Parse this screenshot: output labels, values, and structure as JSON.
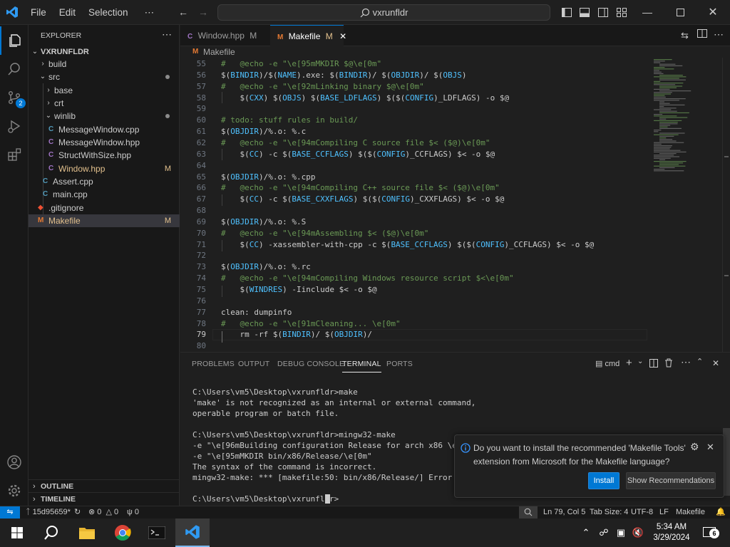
{
  "titlebar": {
    "menus": [
      "File",
      "Edit",
      "Selection",
      "⋯"
    ],
    "search": "vxrunfldr"
  },
  "sidebar": {
    "header": "EXPLORER",
    "more": "⋯",
    "root": "VXRUNFLDR",
    "items": [
      {
        "label": "build",
        "badge": ""
      },
      {
        "label": "src",
        "badge": "dot"
      },
      {
        "label": "base",
        "badge": ""
      },
      {
        "label": "crt",
        "badge": ""
      },
      {
        "label": "winlib",
        "badge": "dot"
      },
      {
        "label": "MessageWindow.cpp",
        "badge": ""
      },
      {
        "label": "MessageWindow.hpp",
        "badge": ""
      },
      {
        "label": "StructWithSize.hpp",
        "badge": ""
      },
      {
        "label": "Window.hpp",
        "badge": "M"
      },
      {
        "label": "Assert.cpp",
        "badge": ""
      },
      {
        "label": "main.cpp",
        "badge": ""
      },
      {
        "label": ".gitignore",
        "badge": ""
      },
      {
        "label": "Makefile",
        "badge": "M"
      }
    ],
    "outline": "OUTLINE",
    "timeline": "TIMELINE"
  },
  "activity": {
    "scm_badge": "2"
  },
  "tabs": [
    {
      "label": "Window.hpp",
      "suffix": "M"
    },
    {
      "label": "Makefile",
      "suffix": "M"
    }
  ],
  "breadcrumb": "Makefile",
  "code": {
    "lines": [
      {
        "n": "55",
        "t": "#   @echo -e \"\\e[95mMKDIR $@\\e[0m\"",
        "k": "cmt"
      },
      {
        "n": "56",
        "t": "$(BINDIR)/$(NAME).exe: $(BINDIR)/ $(OBJDIR)/ $(OBJS)",
        "k": ""
      },
      {
        "n": "57",
        "t": "#   @echo -e \"\\e[92mLinking binary $@\\e[0m\"",
        "k": "cmt"
      },
      {
        "n": "58",
        "t": "    $(CXX) $(OBJS) $(BASE_LDFLAGS) $($(CONFIG)_LDFLAGS) -o $@",
        "k": ""
      },
      {
        "n": "59",
        "t": "",
        "k": ""
      },
      {
        "n": "60",
        "t": "# todo: stuff rules in build/",
        "k": "cmt"
      },
      {
        "n": "61",
        "t": "$(OBJDIR)/%.o: %.c",
        "k": ""
      },
      {
        "n": "62",
        "t": "#   @echo -e \"\\e[94mCompiling C source file $< ($@)\\e[0m\"",
        "k": "cmt"
      },
      {
        "n": "63",
        "t": "    $(CC) -c $(BASE_CCFLAGS) $($(CONFIG)_CCFLAGS) $< -o $@",
        "k": ""
      },
      {
        "n": "64",
        "t": "",
        "k": ""
      },
      {
        "n": "65",
        "t": "$(OBJDIR)/%.o: %.cpp",
        "k": ""
      },
      {
        "n": "66",
        "t": "#   @echo -e \"\\e[94mCompiling C++ source file $< ($@)\\e[0m\"",
        "k": "cmt"
      },
      {
        "n": "67",
        "t": "    $(CC) -c $(BASE_CXXFLAGS) $($(CONFIG)_CXXFLAGS) $< -o $@",
        "k": ""
      },
      {
        "n": "68",
        "t": "",
        "k": ""
      },
      {
        "n": "69",
        "t": "$(OBJDIR)/%.o: %.S",
        "k": ""
      },
      {
        "n": "70",
        "t": "#   @echo -e \"\\e[94mAssembling $< ($@)\\e[0m\"",
        "k": "cmt"
      },
      {
        "n": "71",
        "t": "    $(CC) -xassembler-with-cpp -c $(BASE_CCFLAGS) $($(CONFIG)_CCFLAGS) $< -o $@",
        "k": ""
      },
      {
        "n": "72",
        "t": "",
        "k": ""
      },
      {
        "n": "73",
        "t": "$(OBJDIR)/%.o: %.rc",
        "k": ""
      },
      {
        "n": "74",
        "t": "#   @echo -e \"\\e[94mCompiling Windows resource script $<\\e[0m\"",
        "k": "cmt"
      },
      {
        "n": "75",
        "t": "    $(WINDRES) -Iinclude $< -o $@",
        "k": ""
      },
      {
        "n": "76",
        "t": "",
        "k": ""
      },
      {
        "n": "77",
        "t": "clean: dumpinfo",
        "k": ""
      },
      {
        "n": "78",
        "t": "#   @echo -e \"\\e[91mCleaning... \\e[0m\"",
        "k": "cmt"
      },
      {
        "n": "79",
        "t": "    rm -rf $(BINDIR)/ $(OBJDIR)/",
        "k": "cur"
      },
      {
        "n": "80",
        "t": "",
        "k": ""
      }
    ]
  },
  "panel": {
    "tabs": [
      "PROBLEMS",
      "OUTPUT",
      "DEBUG CONSOLE",
      "TERMINAL",
      "PORTS"
    ],
    "shell": "cmd",
    "terminal": [
      "C:\\Users\\vm5\\Desktop\\vxrunfldr>make",
      "'make' is not recognized as an internal or external command,",
      "operable program or batch file.",
      "",
      "C:\\Users\\vm5\\Desktop\\vxrunfldr>mingw32-make",
      "-e \"\\e[96mBuilding configuration Release for arch x86 \\e[0m\"",
      "-e \"\\e[95mMKDIR bin/x86/Release/\\e[0m\"",
      "The syntax of the command is incorrect.",
      "mingw32-make: *** [makefile:50: bin/x86/Release/] Error 1",
      "",
      "C:\\Users\\vm5\\Desktop\\vxrunfldr>"
    ]
  },
  "notification": {
    "message": "Do you want to install the recommended 'Makefile Tools' extension from Microsoft for the Makefile language?",
    "install": "Install",
    "recommend": "Show Recommendations"
  },
  "statusbar": {
    "branch": "15d95659*",
    "errors": "0",
    "warnings": "0",
    "ports": "0",
    "position": "Ln 79, Col 5",
    "tabsize": "Tab Size: 4",
    "encoding": "UTF-8",
    "eol": "LF",
    "language": "Makefile"
  },
  "taskbar": {
    "time": "5:34 AM",
    "date": "3/29/2024",
    "notifications": "6"
  }
}
